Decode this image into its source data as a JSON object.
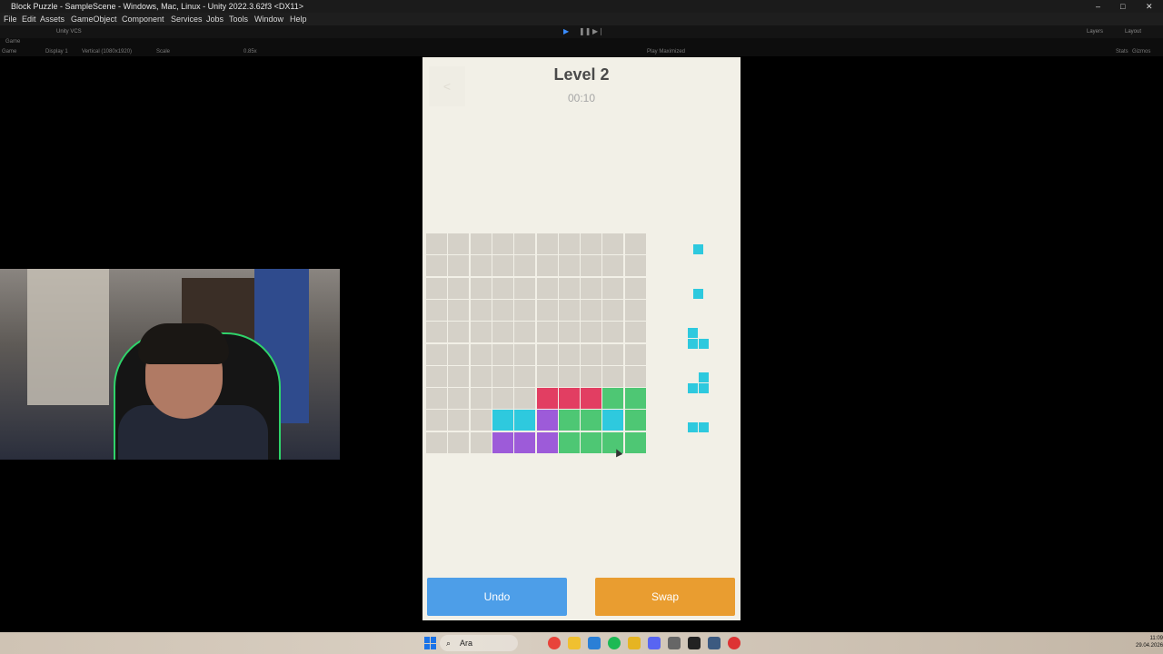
{
  "window": {
    "title": "Block Puzzle - SampleScene - Windows, Mac, Linux - Unity 2022.3.62f3 <DX11>",
    "minimize": "–",
    "maximize": "□",
    "close": "✕"
  },
  "menu": [
    "File",
    "Edit",
    "Assets",
    "GameObject",
    "Component",
    "Services",
    "Jobs",
    "Tools",
    "Window",
    "Help"
  ],
  "toolbar": {
    "vcs": "Unity VCS",
    "layers": "Layers",
    "layout": "Layout"
  },
  "gamebar": {
    "tab": "Game",
    "view": "Game",
    "display": "Display 1",
    "resolution": "Vertical (1080x1920)",
    "scale_label": "Scale",
    "scale_value": "0.85x",
    "play_mode": "Play Maximized",
    "stats": "Stats",
    "gizmos": "Gizmos"
  },
  "game": {
    "back": "<",
    "level": "Level 2",
    "timer": "00:10",
    "undo": "Undo",
    "swap": "Swap",
    "board_size": 10,
    "colors": {
      "empty": "#d5d1c8",
      "red": "#e23e62",
      "green": "#4ec774",
      "cyan": "#2ec9de",
      "purple": "#9d5bd9"
    },
    "filled_cells": [
      {
        "r": 7,
        "c": 5,
        "color": "red"
      },
      {
        "r": 7,
        "c": 6,
        "color": "red"
      },
      {
        "r": 7,
        "c": 7,
        "color": "red"
      },
      {
        "r": 7,
        "c": 8,
        "color": "green"
      },
      {
        "r": 7,
        "c": 9,
        "color": "green"
      },
      {
        "r": 8,
        "c": 3,
        "color": "cyan"
      },
      {
        "r": 8,
        "c": 4,
        "color": "cyan"
      },
      {
        "r": 8,
        "c": 5,
        "color": "purple"
      },
      {
        "r": 8,
        "c": 6,
        "color": "green"
      },
      {
        "r": 8,
        "c": 7,
        "color": "green"
      },
      {
        "r": 8,
        "c": 8,
        "color": "cyan"
      },
      {
        "r": 8,
        "c": 9,
        "color": "green"
      },
      {
        "r": 9,
        "c": 3,
        "color": "purple"
      },
      {
        "r": 9,
        "c": 4,
        "color": "purple"
      },
      {
        "r": 9,
        "c": 5,
        "color": "purple"
      },
      {
        "r": 9,
        "c": 6,
        "color": "green"
      },
      {
        "r": 9,
        "c": 7,
        "color": "green"
      },
      {
        "r": 9,
        "c": 8,
        "color": "green"
      },
      {
        "r": 9,
        "c": 9,
        "color": "green"
      }
    ],
    "tray_pieces": [
      {
        "name": "single",
        "cells": [
          [
            0,
            0
          ]
        ]
      },
      {
        "name": "single",
        "cells": [
          [
            0,
            0
          ]
        ]
      },
      {
        "name": "l-corner",
        "cells": [
          [
            0,
            0
          ],
          [
            1,
            0
          ],
          [
            1,
            1
          ]
        ]
      },
      {
        "name": "j-corner",
        "cells": [
          [
            0,
            1
          ],
          [
            1,
            0
          ],
          [
            1,
            1
          ]
        ]
      },
      {
        "name": "domino",
        "cells": [
          [
            0,
            0
          ],
          [
            0,
            1
          ]
        ]
      }
    ]
  },
  "taskbar": {
    "search": "Ara",
    "time": "11:09",
    "date": "29.04.2026"
  }
}
